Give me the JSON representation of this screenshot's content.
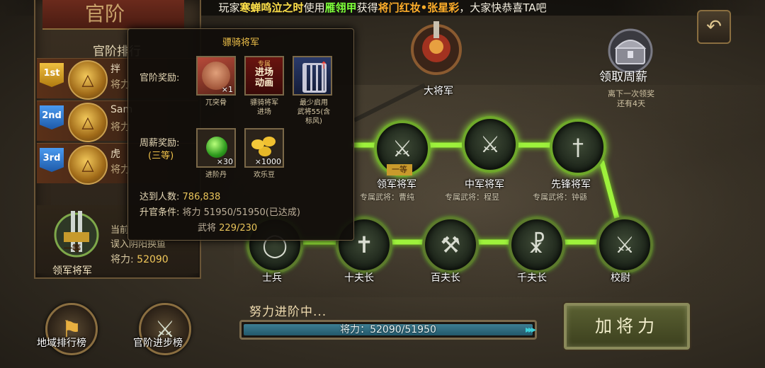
{
  "banner": {
    "prefix": "玩家",
    "player": "寒蝉鸣泣之时",
    "mid1": "使用",
    "item": "雁翎甲",
    "mid2": "获得",
    "reward": "将门红妆•张星彩",
    "suffix": "，大家快恭喜TA吧"
  },
  "left_panel": {
    "title": "官阶",
    "rank_header": "官阶排行",
    "rows": [
      {
        "badge": "1st",
        "name": "拌",
        "sub": "将力",
        "color": "gold"
      },
      {
        "badge": "2nd",
        "name": "Sam",
        "sub": "将力",
        "color": "blue"
      },
      {
        "badge": "3rd",
        "name": "虎",
        "sub": "将力",
        "color": "blue"
      }
    ],
    "my_rank": {
      "emblem_text": "一等",
      "label": "领军将军",
      "line1": "当前",
      "line2": "误入阴阳换鱼",
      "power_label": "将力:",
      "power_value": "52090"
    }
  },
  "bottom_buttons": [
    {
      "label": "地域排行榜",
      "icon": "map-pin-icon"
    },
    {
      "label": "官阶进步榜",
      "icon": "crossed-swords-icon"
    }
  ],
  "tooltip": {
    "title": "骠骑将军",
    "reward_label": "官阶奖励:",
    "rewards": [
      {
        "caption": "兀突骨",
        "qty": "×1",
        "icon": "warrior-portrait-icon"
      },
      {
        "caption": "骠骑将军\n进场",
        "qty": "",
        "icon": "entrance-animation-icon",
        "badge_top": "专属",
        "badge_main": "进场\n动画"
      },
      {
        "caption": "最少启用\n武将55(含\n标风)",
        "qty": "",
        "icon": "armor-cage-icon"
      }
    ],
    "salary_label": "周薪奖励:",
    "salary_grade": "(三等)",
    "salary_items": [
      {
        "caption": "进阶丹",
        "qty": "×30",
        "icon": "green-pill-icon"
      },
      {
        "caption": "欢乐豆",
        "qty": "×1000",
        "icon": "gold-beans-icon"
      }
    ],
    "reached_label": "达到人数:",
    "reached_value": "786,838",
    "cond_label": "升官条件:",
    "cond_power": "将力 51950/51950(已达成)",
    "cond_general_prefix": "武将",
    "cond_general_value": "229/230"
  },
  "tree": {
    "top_node": {
      "name": "大将军"
    },
    "upper": [
      {
        "name": "领军将军",
        "exc": "专属武将：曹纯",
        "badge": "一等"
      },
      {
        "name": "中军将军",
        "exc": "专属武将：程昱"
      },
      {
        "name": "先锋将军",
        "exc": "专属武将：钟繇"
      }
    ],
    "lower": [
      {
        "name": "士兵"
      },
      {
        "name": "十夫长"
      },
      {
        "name": "百夫长"
      },
      {
        "name": "千夫长"
      },
      {
        "name": "校尉"
      }
    ]
  },
  "salary_chest": {
    "label": "领取周薪",
    "line1": "离下一次领奖",
    "line2": "还有4天"
  },
  "progress": {
    "title": "努力进阶中...",
    "text": "将力：52090/51950",
    "fraction": 1.0
  },
  "add_button": {
    "label": "加将力"
  },
  "colors": {
    "node_glow": "#8ee03a",
    "gold": "#f0c24a",
    "bar": "#3d7d92"
  }
}
